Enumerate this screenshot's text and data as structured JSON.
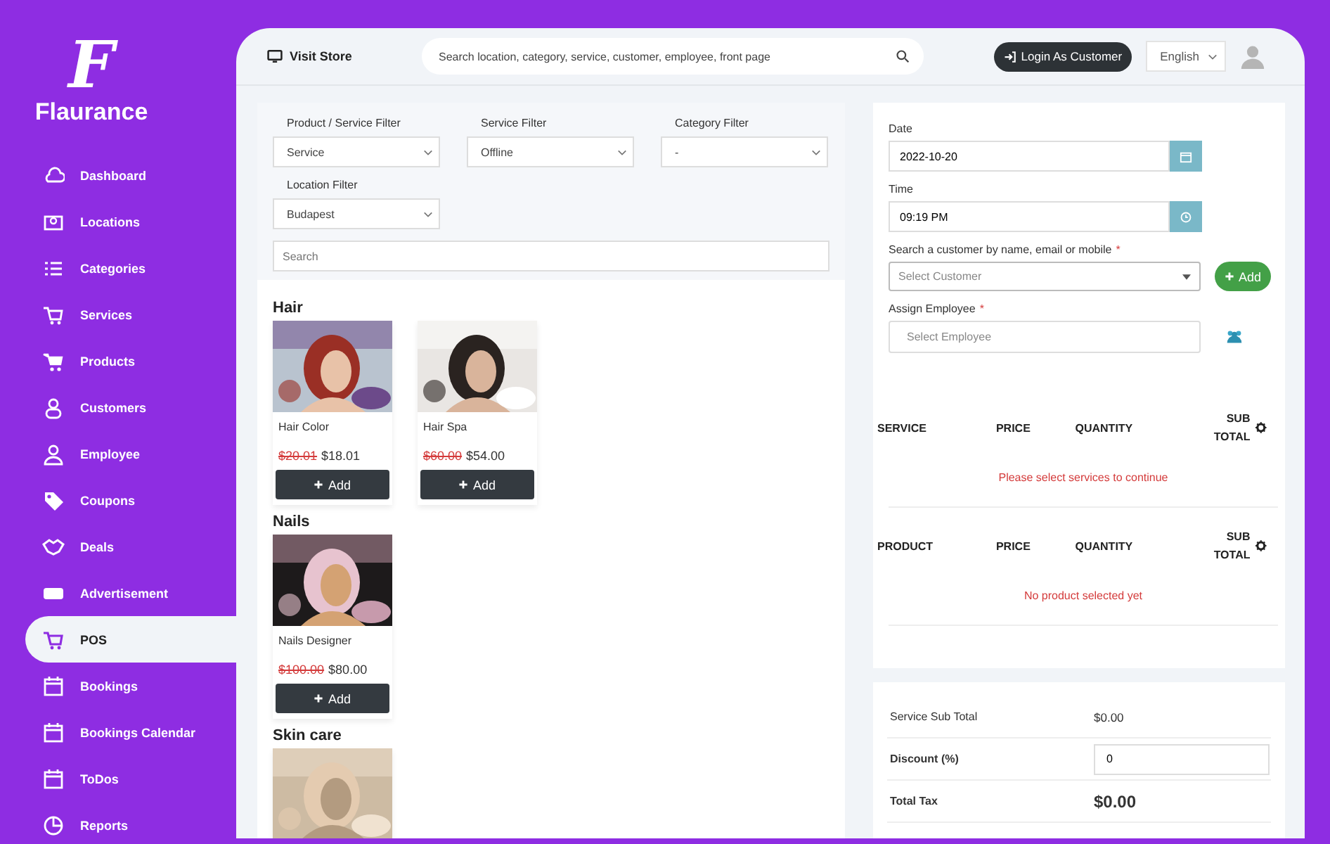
{
  "brand": {
    "logo_letter": "F",
    "name": "Flaurance"
  },
  "sidebar": {
    "items": [
      {
        "label": "Dashboard",
        "selected": false
      },
      {
        "label": "Locations",
        "selected": false
      },
      {
        "label": "Categories",
        "selected": false
      },
      {
        "label": "Services",
        "selected": false
      },
      {
        "label": "Products",
        "selected": false
      },
      {
        "label": "Customers",
        "selected": false
      },
      {
        "label": "Employee",
        "selected": false
      },
      {
        "label": "Coupons",
        "selected": false
      },
      {
        "label": "Deals",
        "selected": false
      },
      {
        "label": "Advertisement",
        "selected": false
      },
      {
        "label": "POS",
        "selected": true
      },
      {
        "label": "Bookings",
        "selected": false
      },
      {
        "label": "Bookings Calendar",
        "selected": false
      },
      {
        "label": "ToDos",
        "selected": false
      },
      {
        "label": "Reports",
        "selected": false
      }
    ]
  },
  "header": {
    "visit_store": "Visit Store",
    "search": {
      "placeholder": "Search location, category, service, customer, employee, front page"
    },
    "login_button": "Login As Customer",
    "language": "English"
  },
  "filters": [
    {
      "label": "Product / Service Filter",
      "value": "Service"
    },
    {
      "label": "Service Filter",
      "value": "Offline"
    },
    {
      "label": "Category Filter",
      "value": "-"
    },
    {
      "label": "Location Filter",
      "value": "Budapest"
    }
  ],
  "product_search": {
    "placeholder": "Search"
  },
  "categories": [
    {
      "name": "Hair",
      "items": [
        {
          "name": "Hair Color",
          "old_price": "$20.01",
          "price": "$18.01",
          "button": "Add",
          "kind": "picture"
        },
        {
          "name": "Hair Spa",
          "old_price": "$60.00",
          "price": "$54.00",
          "button": "Add",
          "kind": "picture"
        }
      ]
    },
    {
      "name": "Nails",
      "items": [
        {
          "name": "Nails Designer",
          "old_price": "$100.00",
          "price": "$80.00",
          "button": "Add",
          "kind": "picture"
        }
      ]
    },
    {
      "name": "Skin care"
    }
  ],
  "booking": {
    "date": {
      "label": "Date",
      "value": "2022-10-20"
    },
    "time": {
      "label": "Time",
      "value": "09:19 PM"
    },
    "customer": {
      "label": "Search a customer by name, email or mobile",
      "required_mark": "*",
      "placeholder": "Select Customer",
      "add_button": "Add"
    },
    "employee": {
      "label": "Assign Employee",
      "required_mark": "*",
      "placeholder": "Select Employee"
    }
  },
  "tables": [
    {
      "columns": [
        "SERVICE",
        "PRICE",
        "QUANTITY",
        "SUB TOTAL"
      ],
      "empty_message": "Please select services to continue"
    },
    {
      "columns": [
        "PRODUCT",
        "PRICE",
        "QUANTITY",
        "SUB TOTAL"
      ],
      "empty_message": "No product selected yet"
    }
  ],
  "totals": {
    "service_sub_total": {
      "label": "Service Sub Total",
      "value": "$0.00"
    },
    "discount": {
      "label": "Discount (%)",
      "value": "0"
    },
    "total_tax": {
      "label": "Total Tax",
      "value": "$0.00"
    }
  }
}
